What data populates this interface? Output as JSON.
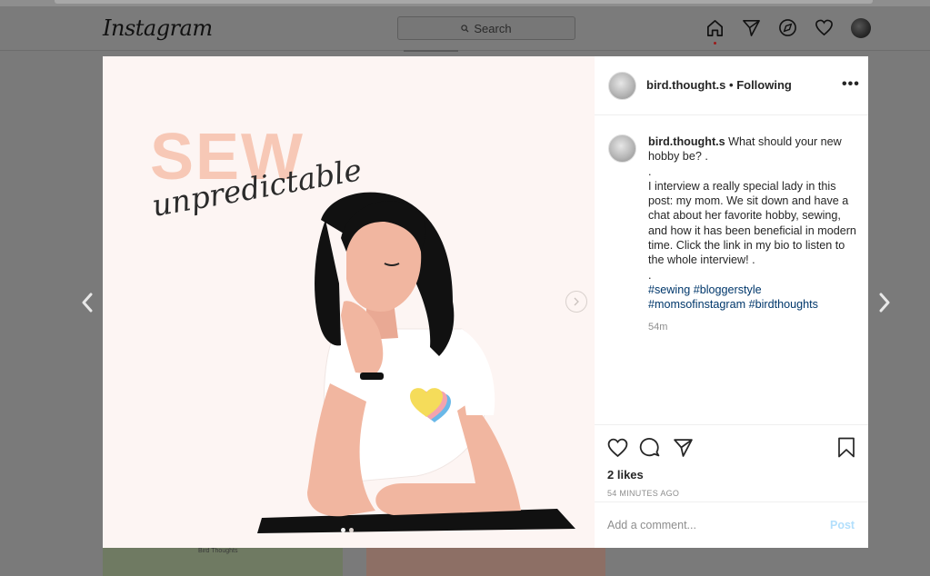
{
  "header": {
    "logo": "Instagram",
    "search_placeholder": "Search",
    "icons": [
      "home-icon",
      "direct-icon",
      "explore-icon",
      "activity-heart-icon",
      "profile-avatar"
    ]
  },
  "background_tile": {
    "text": "Bird Thoughts"
  },
  "post_image": {
    "title": "SEW",
    "subtitle": "unpredictable",
    "carousel_dots": 2,
    "active_dot": 0
  },
  "post": {
    "username": "bird.thought.s",
    "separator": "•",
    "follow_status": "Following",
    "more_label": "•••",
    "caption_user": "bird.thought.s",
    "caption_line1": "What should your new hobby be? .",
    "caption_dot1": ".",
    "caption_body": "I interview a really special lady in this post: my mom. We sit down and have a chat about her favorite hobby, sewing, and how it has been beneficial in modern time. Click the link in my bio to listen to the whole interview! .",
    "caption_dot2": ".",
    "hashtags": "#sewing #bloggerstyle #momsofinstagram #birdthoughts",
    "relative_time": "54m",
    "likes": "2 likes",
    "timestamp": "54 MINUTES AGO",
    "comment_placeholder": "Add a comment...",
    "post_button": "Post"
  },
  "colors": {
    "link": "#00376b",
    "post_button_disabled": "#b2dffc",
    "sew_title": "#f7c8b6",
    "image_bg": "#fdf5f3"
  }
}
